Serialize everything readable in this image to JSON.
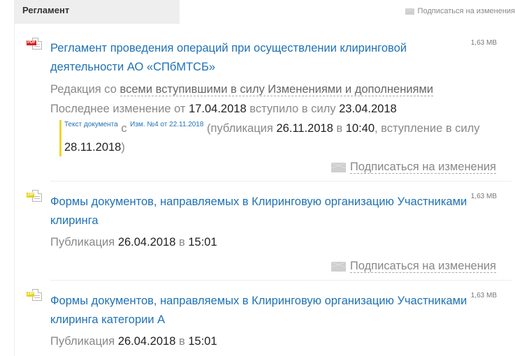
{
  "section": {
    "title": "Регламент",
    "subscribe_label": "Подписаться на изменения"
  },
  "items": [
    {
      "file_type": "PDF",
      "size": "1,63 MB",
      "title": "Регламент проведения операций при осуществлении клиринговой деятельности АО «СПбМТСБ»",
      "edition_prefix": "Редакция со",
      "edition_link": "всеми вступившими в силу Изменениями и дополнениями",
      "last_change_label": "Последнее изменение от",
      "last_change_date": "17.04.2018",
      "effective_label": "вступило в силу",
      "effective_date": "23.04.2018",
      "change": {
        "doc_text_link": "Текст документа",
        "with": "с",
        "amendment_link": "Изм. №4 от 22.11.2018",
        "publication_label": "(публикация",
        "publication_date": "26.11.2018",
        "at": "в",
        "publication_time": "10:40",
        "entry_label": ", вступление в силу",
        "entry_date": "28.11.2018",
        "close": ")"
      },
      "subscribe_label": "Подписаться на изменения"
    },
    {
      "file_type": "ZIP",
      "size": "1,63 MB",
      "title": "Формы документов, направляемых в Клиринговую организацию Участниками клиринга",
      "publication_label": "Публикация",
      "publication_date": "26.04.2018",
      "at": "в",
      "publication_time": "15:01",
      "subscribe_label": "Подписаться на изменения"
    },
    {
      "file_type": "ZIP",
      "size": "1,63 MB",
      "title": "Формы документов, направляемых в Клиринговую организацию Участниками клиринга категории А",
      "publication_label": "Публикация",
      "publication_date": "26.04.2018",
      "at": "в",
      "publication_time": "15:01"
    }
  ],
  "colors": {
    "link": "#1f71b6",
    "muted": "#888888",
    "pdf_badge": "#d62020",
    "zip_badge": "#e5d414",
    "change_bar": "#f2d22e"
  }
}
